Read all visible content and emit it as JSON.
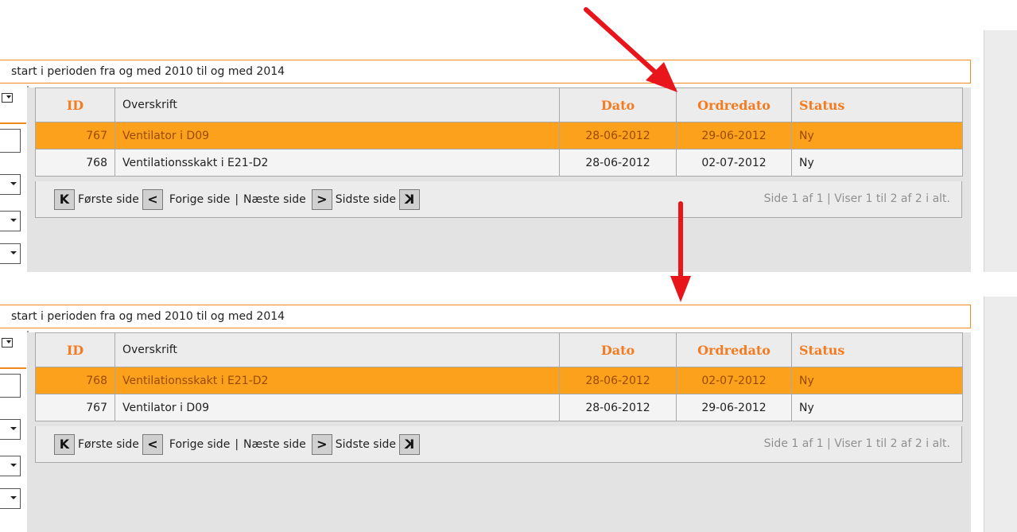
{
  "period_text": "start i perioden fra og med 2010 til og med 2014",
  "columns": {
    "id": "ID",
    "title": "Overskrift",
    "date": "Dato",
    "order_date": "Ordredato",
    "status": "Status"
  },
  "before": {
    "rows": [
      {
        "id": "767",
        "title": "Ventilator i D09",
        "date": "28-06-2012",
        "order_date": "29-06-2012",
        "status": "Ny"
      },
      {
        "id": "768",
        "title": "Ventilationsskakt i E21-D2",
        "date": "28-06-2012",
        "order_date": "02-07-2012",
        "status": "Ny"
      }
    ]
  },
  "after": {
    "rows": [
      {
        "id": "768",
        "title": "Ventilationsskakt i E21-D2",
        "date": "28-06-2012",
        "order_date": "02-07-2012",
        "status": "Ny"
      },
      {
        "id": "767",
        "title": "Ventilator i D09",
        "date": "28-06-2012",
        "order_date": "29-06-2012",
        "status": "Ny"
      }
    ]
  },
  "pager": {
    "first_icon": "K",
    "first_label": "Første side",
    "prev_icon": "<",
    "prev_label": "Forige side",
    "separator": "|",
    "next_label": "Næste side",
    "next_icon": ">",
    "last_label": "Sidste side",
    "last_icon": "K",
    "info": "Side 1 af 1 | Viser 1 til 2 af 2 i alt."
  },
  "colors": {
    "accent": "#f47b20",
    "selected_row": "#fba11b",
    "arrow": "#e8151b"
  },
  "icons": [
    "first-page-icon",
    "prev-page-icon",
    "next-page-icon",
    "last-page-icon",
    "dropdown-icon",
    "red-arrow-icon"
  ]
}
